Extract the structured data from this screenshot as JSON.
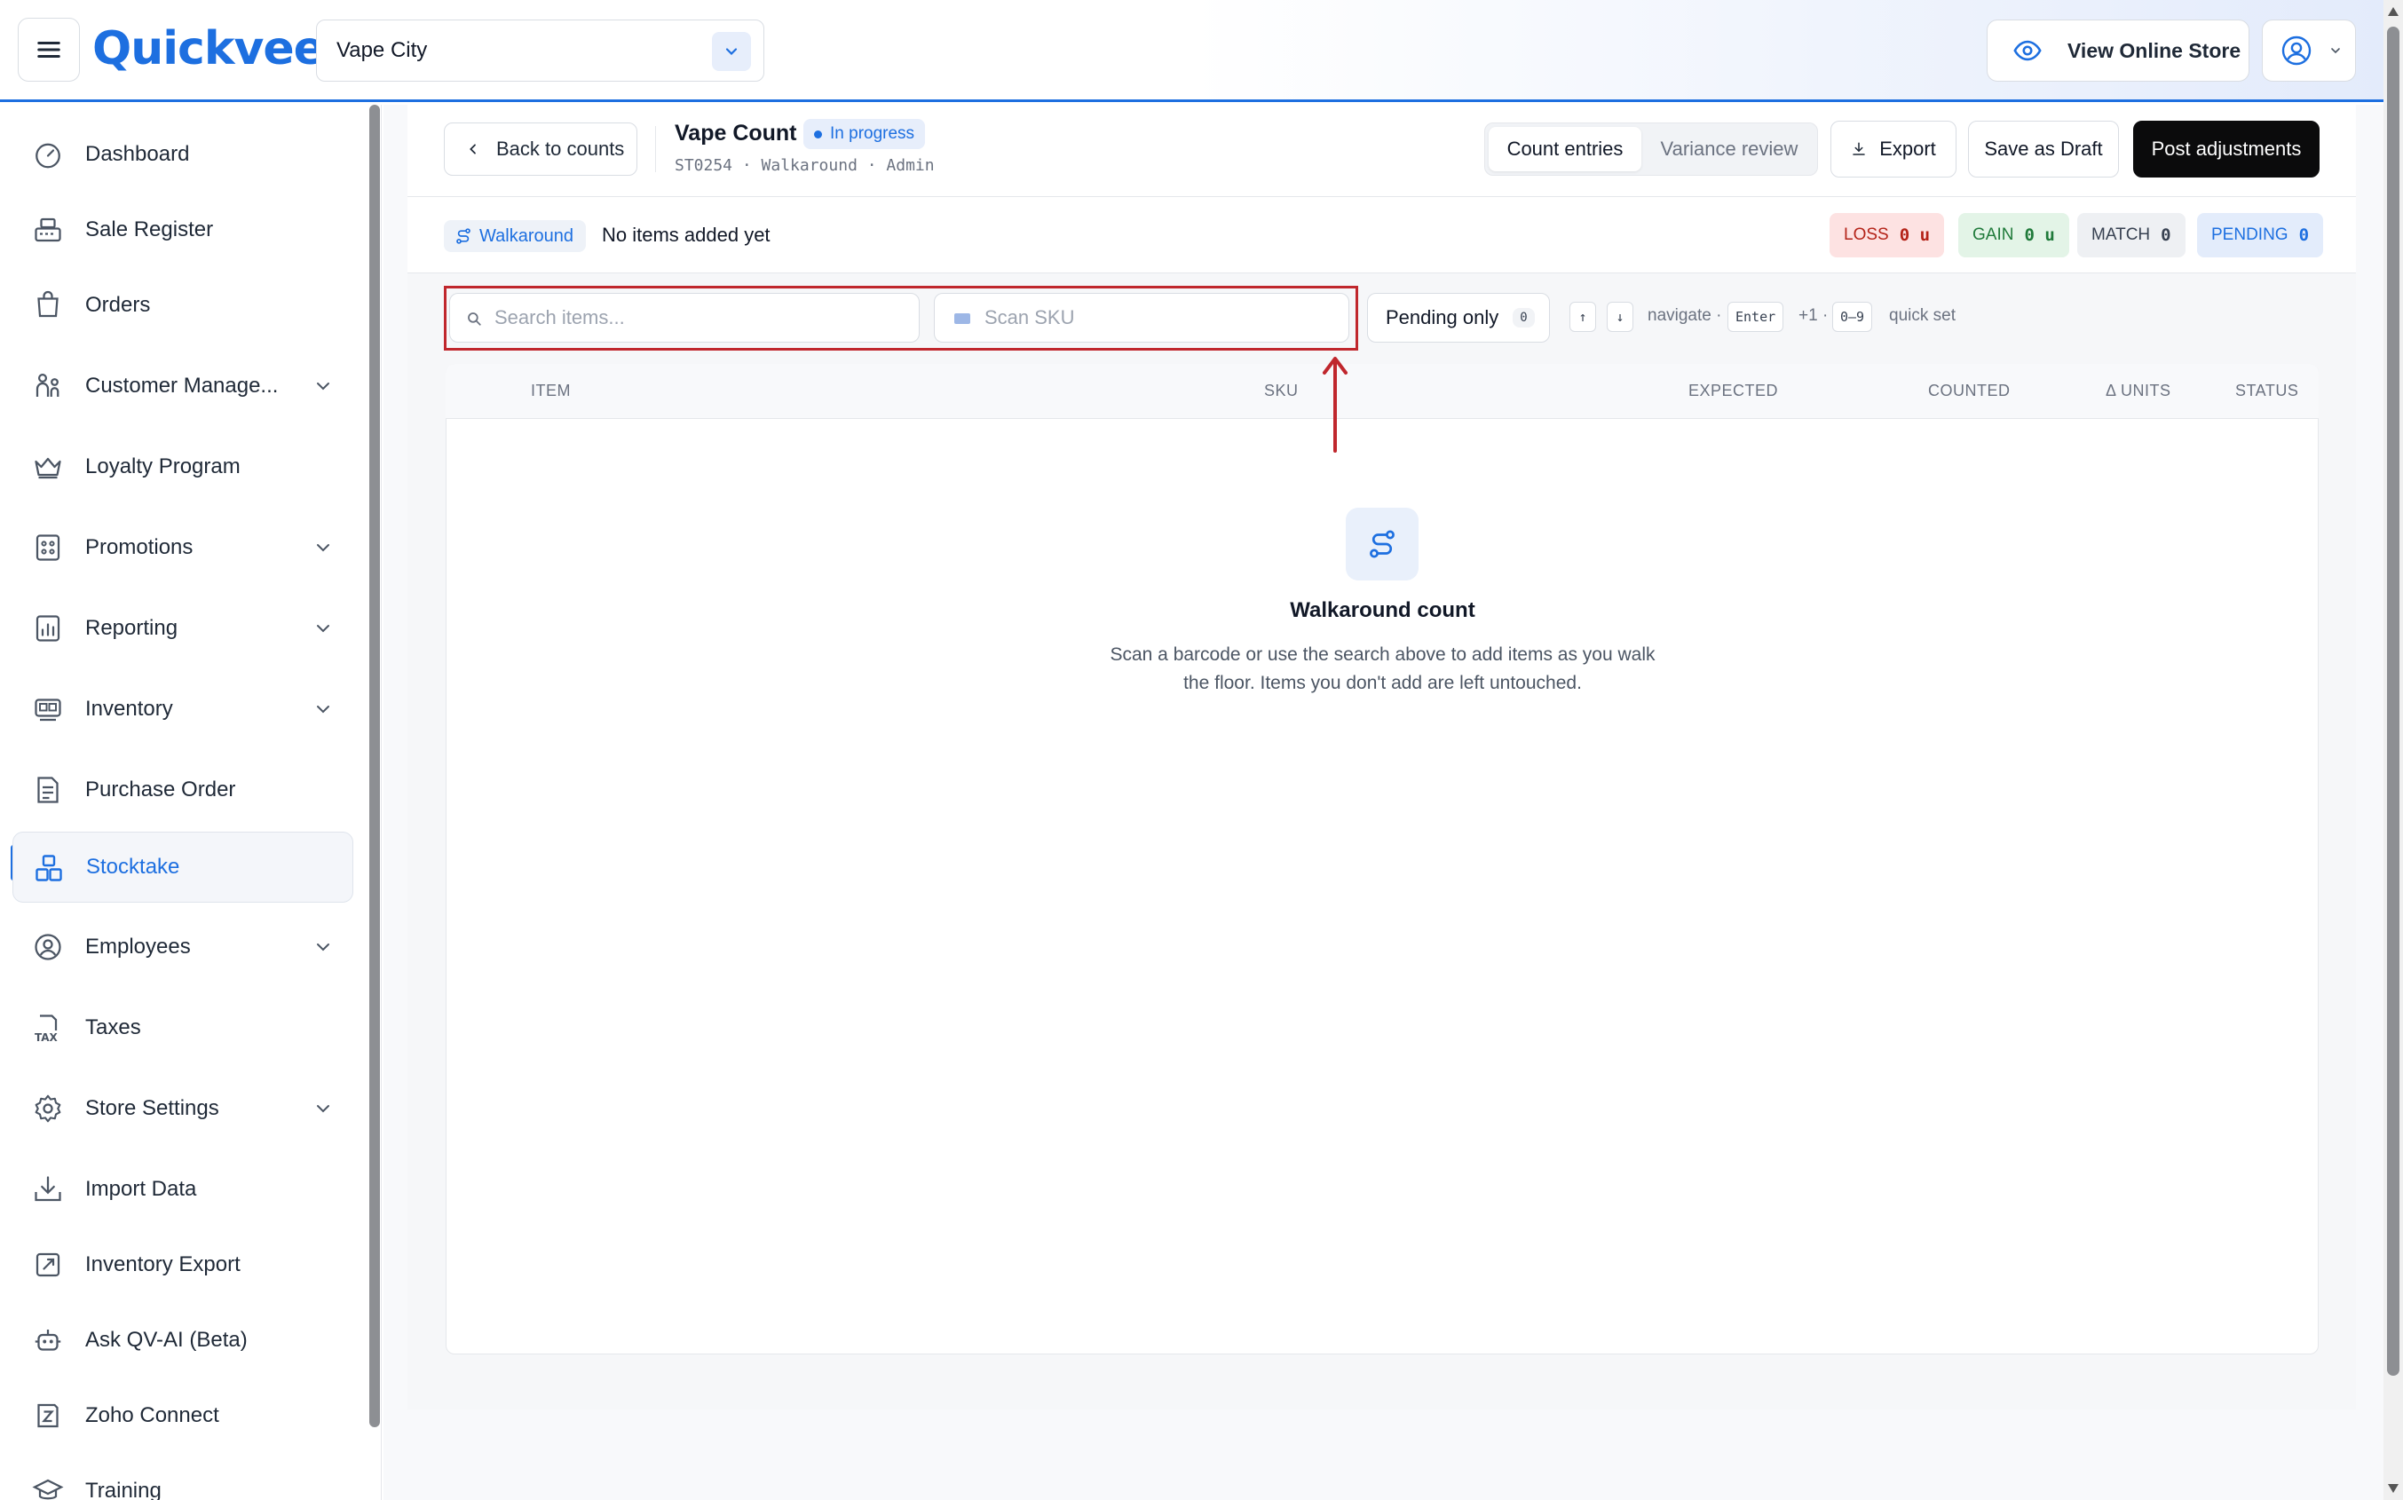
{
  "app": {
    "logo_text": "Quickvee",
    "brand_color": "#1d6fe0"
  },
  "header": {
    "store_name": "Vape City",
    "view_store_label": "View Online Store"
  },
  "sidebar": {
    "items": [
      {
        "label": "Dashboard",
        "icon": "dashboard-icon"
      },
      {
        "label": "Sale Register",
        "icon": "register-icon"
      },
      {
        "label": "Orders",
        "icon": "orders-icon"
      },
      {
        "label": "Customer Manage...",
        "icon": "customers-icon"
      },
      {
        "label": "Loyalty Program",
        "icon": "crown-icon"
      },
      {
        "label": "Promotions",
        "icon": "promotions-icon"
      },
      {
        "label": "Reporting",
        "icon": "reporting-icon"
      },
      {
        "label": "Inventory",
        "icon": "inventory-icon"
      },
      {
        "label": "Purchase Order",
        "icon": "purchase-order-icon"
      },
      {
        "label": "Stocktake",
        "icon": "stocktake-icon"
      },
      {
        "label": "Employees",
        "icon": "employees-icon"
      },
      {
        "label": "Taxes",
        "icon": "taxes-icon"
      },
      {
        "label": "Store Settings",
        "icon": "settings-icon"
      },
      {
        "label": "Import Data",
        "icon": "import-icon"
      },
      {
        "label": "Inventory Export",
        "icon": "export-icon"
      },
      {
        "label": "Ask QV-AI (Beta)",
        "icon": "robot-icon"
      },
      {
        "label": "Zoho Connect",
        "icon": "zoho-icon"
      },
      {
        "label": "Training",
        "icon": "training-icon"
      }
    ],
    "active": "Stocktake",
    "tax_icon_text": "TAX"
  },
  "count": {
    "back_label": "Back to counts",
    "title": "Vape Count",
    "status": "In progress",
    "meta": "ST0254 · Walkaround · Admin",
    "tabs": [
      "Count entries",
      "Variance review"
    ],
    "active_tab": "Count entries",
    "export_label": "Export",
    "draft_label": "Save as Draft",
    "post_label": "Post adjustments"
  },
  "info": {
    "mode_label": "Walkaround",
    "no_items": "No items added yet",
    "stats": {
      "loss_label": "LOSS",
      "loss_value": "0 u",
      "gain_label": "GAIN",
      "gain_value": "0 u",
      "match_label": "MATCH",
      "match_value": "0",
      "pending_label": "PENDING",
      "pending_value": "0"
    }
  },
  "toolbar": {
    "search_placeholder": "Search items...",
    "scan_placeholder": "Scan SKU",
    "pending_only_label": "Pending only",
    "pending_only_count": "0",
    "key_up": "↑",
    "key_down": "↓",
    "navigate_hint": "navigate ·",
    "key_enter": "Enter",
    "plus_one_hint": "+1 ·",
    "key_digits": "0–9",
    "quick_set_hint": "quick set"
  },
  "table": {
    "columns": [
      "ITEM",
      "SKU",
      "EXPECTED",
      "COUNTED",
      "Δ UNITS",
      "STATUS"
    ]
  },
  "empty_state": {
    "title": "Walkaround count",
    "description": "Scan a barcode or use the search above to add items as you walk the floor. Items you don't add are left untouched."
  },
  "colors": {
    "accent": "#1d6fe0",
    "annotation_red": "#c0272d",
    "loss_bg": "#fde2e2",
    "gain_bg": "#e3f4e7",
    "pending_bg": "#e3ecfb"
  }
}
